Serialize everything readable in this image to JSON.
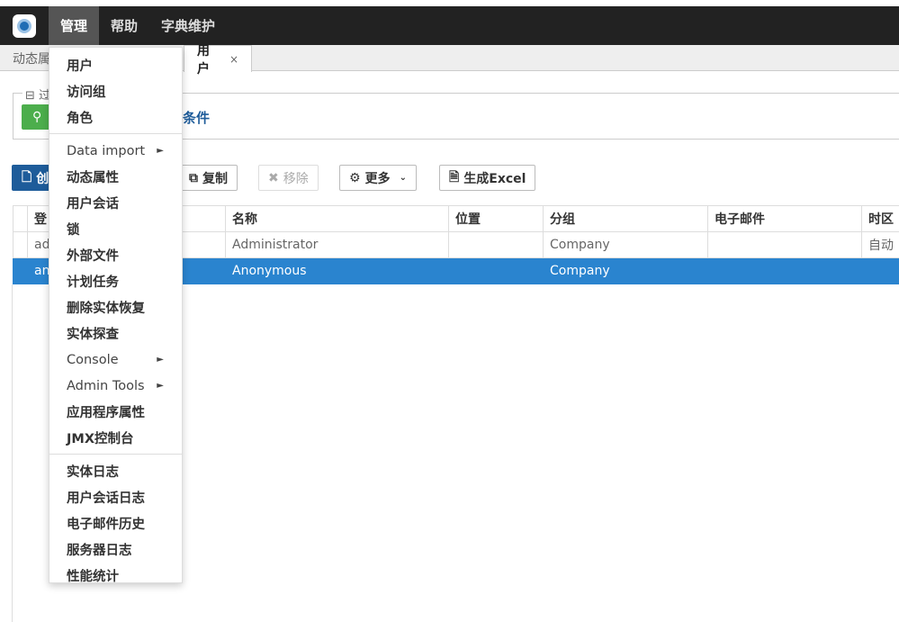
{
  "topbar": {
    "menus": [
      "管理",
      "帮助",
      "字典维护"
    ]
  },
  "tabs": {
    "left_partial": "动态属",
    "current": "用户",
    "close": "×"
  },
  "filter": {
    "legend": "⊟ 过",
    "search_icon": "search-icon",
    "add_condition": "条件"
  },
  "buttons": {
    "create": "创",
    "copy": "复制",
    "remove": "移除",
    "more": "更多",
    "excel": "生成Excel"
  },
  "table": {
    "headers": [
      "登",
      "名称",
      "位置",
      "分组",
      "电子邮件",
      "时区"
    ],
    "rows": [
      [
        "ad",
        "Administrator",
        "",
        "Company",
        "",
        "自动"
      ],
      [
        "an",
        "Anonymous",
        "",
        "Company",
        "",
        ""
      ]
    ]
  },
  "dropdown": {
    "group1": [
      "用户",
      "访问组",
      "角色"
    ],
    "group2": [
      {
        "label": "Data import",
        "sub": true
      },
      {
        "label": "动态属性"
      },
      {
        "label": "用户会话"
      },
      {
        "label": "锁"
      },
      {
        "label": "外部文件"
      },
      {
        "label": "计划任务"
      },
      {
        "label": "删除实体恢复"
      },
      {
        "label": "实体探查"
      },
      {
        "label": "Console",
        "sub": true
      },
      {
        "label": "Admin Tools",
        "sub": true
      },
      {
        "label": "应用程序属性"
      },
      {
        "label": "JMX控制台"
      }
    ],
    "group3": [
      "实体日志",
      "用户会话日志",
      "电子邮件历史",
      "服务器日志",
      "性能统计"
    ],
    "submenu_arrow": "►"
  },
  "colors": {
    "selected_row": "#2a84cf",
    "primary": "#1e5c9a",
    "search": "#4cae4c"
  }
}
